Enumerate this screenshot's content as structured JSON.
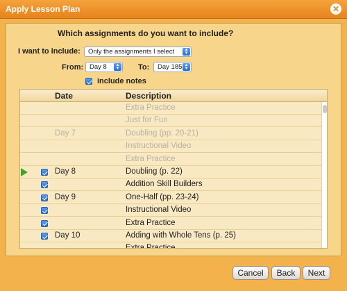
{
  "window": {
    "title": "Apply Lesson Plan",
    "close_icon": "close-icon"
  },
  "form": {
    "question": "Which assignments do you want to include?",
    "include_label": "I want to include:",
    "include_value": "Only the assignments I select",
    "from_label": "From:",
    "from_value": "Day 8",
    "to_label": "To:",
    "to_value": "Day 185",
    "notes_label": "include notes",
    "notes_checked": true
  },
  "table": {
    "columns": [
      "Date",
      "Description"
    ],
    "rows": [
      {
        "date": "",
        "description": "Extra Practice",
        "checked": false,
        "dim": true
      },
      {
        "date": "",
        "description": "Just for Fun",
        "checked": false,
        "dim": true
      },
      {
        "date": "Day 7",
        "description": "Doubling (pp. 20-21)",
        "checked": false,
        "dim": true
      },
      {
        "date": "",
        "description": "Instructional Video",
        "checked": false,
        "dim": true
      },
      {
        "date": "",
        "description": "Extra Practice",
        "checked": false,
        "dim": true
      },
      {
        "date": "Day 8",
        "description": "Doubling (p. 22)",
        "checked": true,
        "dim": false,
        "current": true
      },
      {
        "date": "",
        "description": "Addition Skill Builders",
        "checked": true,
        "dim": false
      },
      {
        "date": "Day 9",
        "description": "One-Half (pp. 23-24)",
        "checked": true,
        "dim": false
      },
      {
        "date": "",
        "description": "Instructional Video",
        "checked": true,
        "dim": false
      },
      {
        "date": "",
        "description": "Extra Practice",
        "checked": true,
        "dim": false
      },
      {
        "date": "Day 10",
        "description": "Adding with Whole Tens (p. 25)",
        "checked": true,
        "dim": false
      },
      {
        "date": "",
        "description": "Extra Practice",
        "checked": false,
        "dim": false
      }
    ]
  },
  "buttons": {
    "cancel": "Cancel",
    "back": "Back",
    "next": "Next"
  },
  "colors": {
    "accent": "#e7831c",
    "panel": "#f7d58a",
    "checkbox": "#2a6fd3",
    "current_marker": "#3ba626"
  }
}
